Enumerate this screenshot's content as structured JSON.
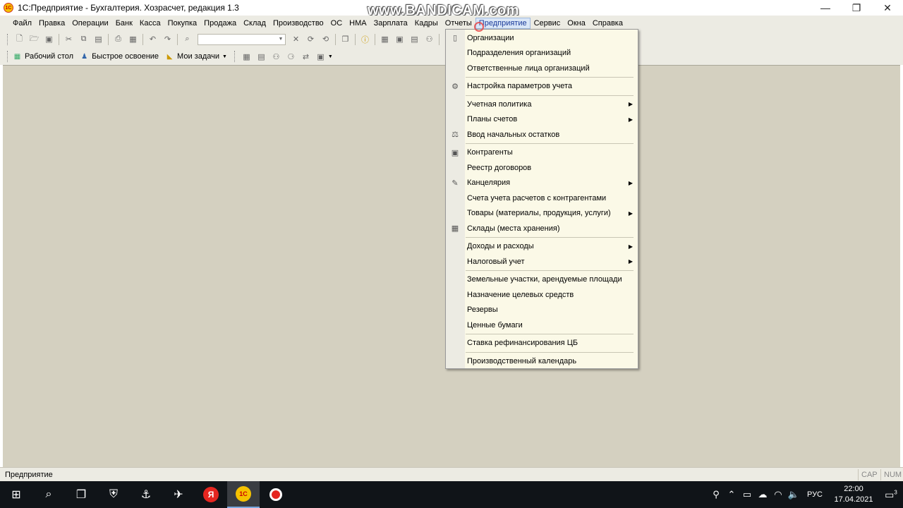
{
  "window": {
    "title": "1С:Предприятие - Бухгалтерия. Хозрасчет, редакция 1.3",
    "watermark": "www.BANDICAM.com",
    "controls": {
      "minimize": "—",
      "restore": "❐",
      "close": "✕"
    }
  },
  "menubar": {
    "items": [
      "Файл",
      "Правка",
      "Операции",
      "Банк",
      "Касса",
      "Покупка",
      "Продажа",
      "Склад",
      "Производство",
      "ОС",
      "НМА",
      "Зарплата",
      "Кадры",
      "Отчеты",
      "Предприятие",
      "Сервис",
      "Окна",
      "Справка"
    ],
    "active": "Предприятие"
  },
  "toolbar2": {
    "desktop": "Рабочий стол",
    "quick": "Быстрое освоение",
    "tasks": "Мои задачи"
  },
  "dropdown": {
    "items": [
      {
        "label": "Организации",
        "icon": "document-icon",
        "submenu": false
      },
      {
        "label": "Подразделения организаций",
        "icon": "",
        "submenu": false
      },
      {
        "label": "Ответственные лица организаций",
        "icon": "",
        "submenu": false,
        "sep_after": true
      },
      {
        "label": "Настройка параметров учета",
        "icon": "gear-icon",
        "submenu": false,
        "sep_after": true
      },
      {
        "label": "Учетная политика",
        "icon": "",
        "submenu": true
      },
      {
        "label": "Планы счетов",
        "icon": "",
        "submenu": true
      },
      {
        "label": "Ввод начальных остатков",
        "icon": "balance-icon",
        "submenu": false,
        "sep_after": true
      },
      {
        "label": "Контрагенты",
        "icon": "counterparty-icon",
        "submenu": false
      },
      {
        "label": "Реестр договоров",
        "icon": "",
        "submenu": false
      },
      {
        "label": "Канцелярия",
        "icon": "office-icon",
        "submenu": true
      },
      {
        "label": "Счета учета расчетов с контрагентами",
        "icon": "",
        "submenu": false
      },
      {
        "label": "Товары (материалы, продукция, услуги)",
        "icon": "",
        "submenu": true
      },
      {
        "label": "Склады (места хранения)",
        "icon": "warehouse-icon",
        "submenu": false,
        "sep_after": true
      },
      {
        "label": "Доходы и расходы",
        "icon": "",
        "submenu": true
      },
      {
        "label": "Налоговый учет",
        "icon": "",
        "submenu": true,
        "sep_after": true
      },
      {
        "label": "Земельные участки, арендуемые площади",
        "icon": "",
        "submenu": false
      },
      {
        "label": "Назначение целевых средств",
        "icon": "",
        "submenu": false
      },
      {
        "label": "Резервы",
        "icon": "",
        "submenu": false
      },
      {
        "label": "Ценные бумаги",
        "icon": "",
        "submenu": false,
        "sep_after": true
      },
      {
        "label": "Ставка рефинансирования ЦБ",
        "icon": "",
        "submenu": false,
        "sep_after": true
      },
      {
        "label": "Производственный календарь",
        "icon": "",
        "submenu": false
      }
    ]
  },
  "statusbar": {
    "text": "Предприятие",
    "cap": "CAP",
    "num": "NUM"
  },
  "taskbar": {
    "lang": "РУС",
    "time": "22:00",
    "date": "17.04.2021",
    "notifications": "3"
  }
}
